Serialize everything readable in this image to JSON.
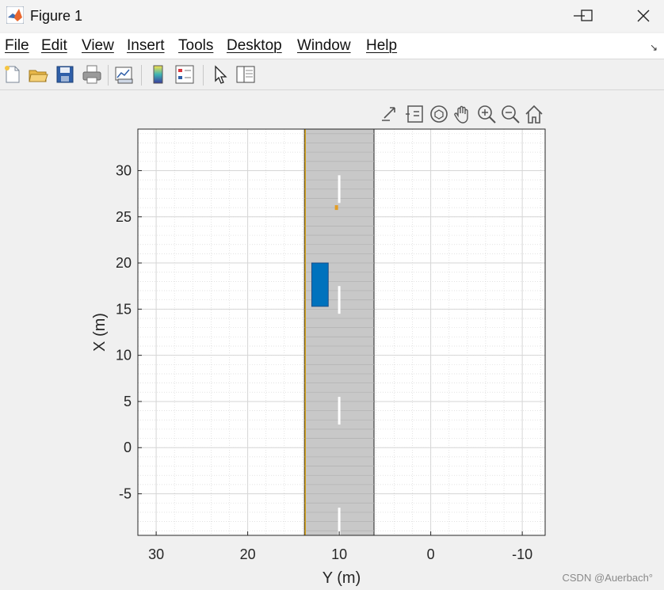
{
  "window": {
    "title": "Figure 1",
    "controls": [
      "minimize",
      "maximize",
      "close"
    ]
  },
  "menu": [
    "File",
    "Edit",
    "View",
    "Insert",
    "Tools",
    "Desktop",
    "Window",
    "Help"
  ],
  "toolbar": {
    "buttons": [
      "new-figure-icon",
      "open-file-icon",
      "save-icon",
      "print-icon",
      "link-plot-icon",
      "insert-colorbar-icon",
      "insert-legend-icon",
      "edit-plot-icon",
      "property-inspector-icon"
    ]
  },
  "axes_toolbar": [
    "export-icon",
    "data-tips-icon",
    "rotate-3d-icon",
    "pan-icon",
    "zoom-in-icon",
    "zoom-out-icon",
    "home-icon"
  ],
  "colors": {
    "road": "#c8c8c8",
    "lane_marking": "#ffffff",
    "vehicle": "#0072bd",
    "pedestrian": "#e39d24",
    "road_edge": "#d4a017"
  },
  "chart_data": {
    "type": "scatter",
    "title": "",
    "xlabel": "Y (m)",
    "ylabel": "X (m)",
    "xlim": [
      -12.5,
      32
    ],
    "ylim": [
      -9.5,
      34.5
    ],
    "x_reversed": true,
    "x_ticks": [
      30,
      20,
      10,
      0,
      -10
    ],
    "x_tick_labels": [
      "30",
      "20",
      "10",
      "0",
      "-10"
    ],
    "y_ticks": [
      -5,
      0,
      5,
      10,
      15,
      20,
      25,
      30
    ],
    "y_tick_labels": [
      "-5",
      "0",
      "5",
      "10",
      "15",
      "20",
      "25",
      "30"
    ],
    "grid": true,
    "minor_grid": true,
    "road": {
      "y_left": 13.8,
      "y_right": 6.2,
      "x_start": -9.5,
      "x_end": 34.5
    },
    "lane_dashes": [
      {
        "y": 10.0,
        "x_from": 26.5,
        "x_to": 29.5
      },
      {
        "y": 10.0,
        "x_from": 14.5,
        "x_to": 17.5
      },
      {
        "y": 10.0,
        "x_from": 2.5,
        "x_to": 5.5
      },
      {
        "y": 10.0,
        "x_from": -9.5,
        "x_to": -6.5
      }
    ],
    "vehicle": {
      "y_left": 13.0,
      "y_right": 11.2,
      "x_bottom": 15.3,
      "x_top": 20.0
    },
    "pedestrian": {
      "y": 10.3,
      "x": 26.0
    }
  },
  "watermark": "CSDN @Auerbach°"
}
